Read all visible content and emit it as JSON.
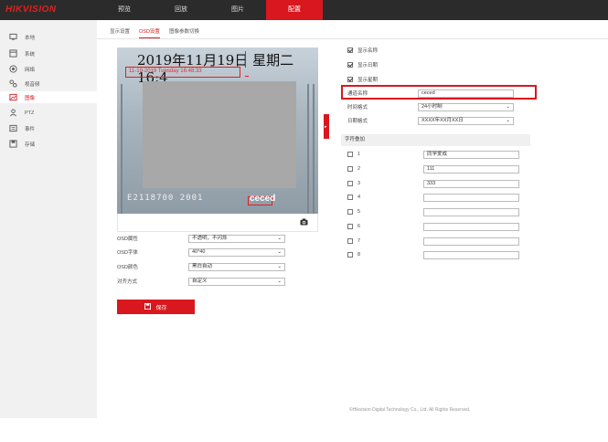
{
  "app": {
    "logo": "HIKVISION"
  },
  "nav": [
    {
      "label": "预览",
      "active": false
    },
    {
      "label": "回放",
      "active": false
    },
    {
      "label": "图片",
      "active": false
    },
    {
      "label": "配置",
      "active": true
    }
  ],
  "sidebar": [
    {
      "label": "本地",
      "icon": "monitor-icon",
      "active": false
    },
    {
      "label": "系统",
      "icon": "system-icon",
      "active": false
    },
    {
      "label": "网络",
      "icon": "globe-icon",
      "active": false
    },
    {
      "label": "视音频",
      "icon": "audio-video-icon",
      "active": false
    },
    {
      "label": "图像",
      "icon": "image-icon",
      "active": true
    },
    {
      "label": "PTZ",
      "icon": "ptz-icon",
      "active": false
    },
    {
      "label": "事件",
      "icon": "event-icon",
      "active": false
    },
    {
      "label": "存储",
      "icon": "storage-icon",
      "active": false
    }
  ],
  "tabs": [
    {
      "label": "显示设置",
      "active": false
    },
    {
      "label": "OSD设置",
      "active": true
    },
    {
      "label": "图像参数切换",
      "active": false
    }
  ],
  "video": {
    "osd_date": "2019年11月19日  星期二  16:4",
    "osd_sub": "11-19-2019 Tuesday 16:48:33",
    "osd_bottom_left": "E2118700  2001",
    "osd_bottom_right": "ceced"
  },
  "left_form": [
    {
      "label": "OSD属性",
      "value": "不透明，不闪烁"
    },
    {
      "label": "OSD字体",
      "value": "40*40"
    },
    {
      "label": "OSD颜色",
      "value": "黑白自动"
    },
    {
      "label": "对齐方式",
      "value": "自定义"
    }
  ],
  "save_label": "保存",
  "display_checks": [
    {
      "label": "显示名称",
      "checked": true
    },
    {
      "label": "显示日期",
      "checked": true
    },
    {
      "label": "显示星期",
      "checked": true
    }
  ],
  "channel_name": {
    "label": "通道名称",
    "value": "ceced"
  },
  "time_format": {
    "label": "时间格式",
    "value": "24小时制"
  },
  "date_format": {
    "label": "日期格式",
    "value": "XXXX年XX月XX日"
  },
  "overlay_section": "字符叠加",
  "overlays": [
    {
      "num": "1",
      "checked": false,
      "value": "同学爱成"
    },
    {
      "num": "2",
      "checked": false,
      "value": "111"
    },
    {
      "num": "3",
      "checked": false,
      "value": "333"
    },
    {
      "num": "4",
      "checked": false,
      "value": ""
    },
    {
      "num": "5",
      "checked": false,
      "value": ""
    },
    {
      "num": "6",
      "checked": false,
      "value": ""
    },
    {
      "num": "7",
      "checked": false,
      "value": ""
    },
    {
      "num": "8",
      "checked": false,
      "value": ""
    }
  ],
  "footer": "©Hikvision Digital Technology Co., Ltd. All Rights Reserved.",
  "colors": {
    "accent": "#d9171e",
    "topbar": "#2b2b2b",
    "sidebar": "#f1f1f1"
  }
}
